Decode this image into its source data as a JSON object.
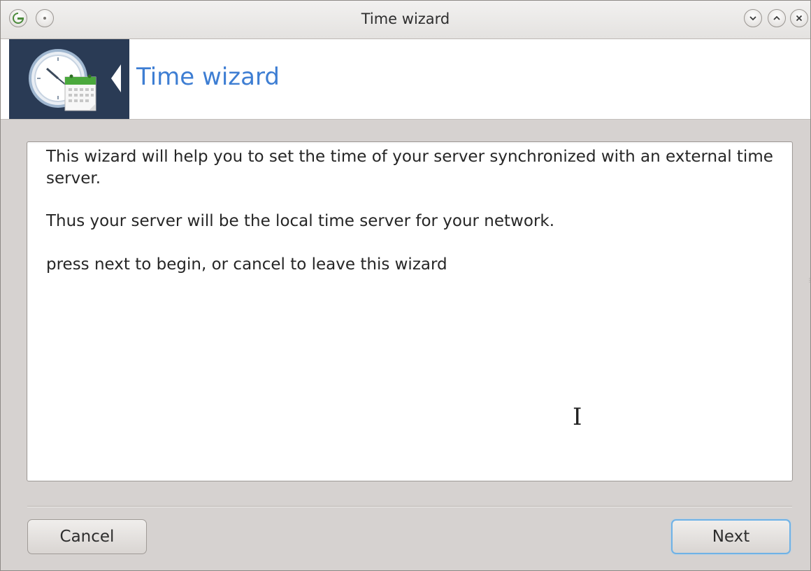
{
  "window": {
    "title": "Time wizard"
  },
  "banner": {
    "title": "Time wizard"
  },
  "content": {
    "paragraph1": "This wizard will help you to set the time of your server synchronized with an external time server.",
    "paragraph2": "Thus your server will be the local time server for your network.",
    "paragraph3": "press next to begin, or cancel to leave this wizard"
  },
  "buttons": {
    "cancel_label": "Cancel",
    "next_label": "Next"
  },
  "icons": {
    "app_menu": "app-menu-icon",
    "sticky": "keep-on-all-desktops-icon",
    "minimize": "minimize-icon",
    "maximize": "maximize-icon",
    "close": "close-icon",
    "banner": "clock-calendar-icon"
  },
  "colors": {
    "accent": "#3e7ed3",
    "banner_icon_bg": "#2a3b55",
    "focus_border": "#6fb2e6"
  }
}
